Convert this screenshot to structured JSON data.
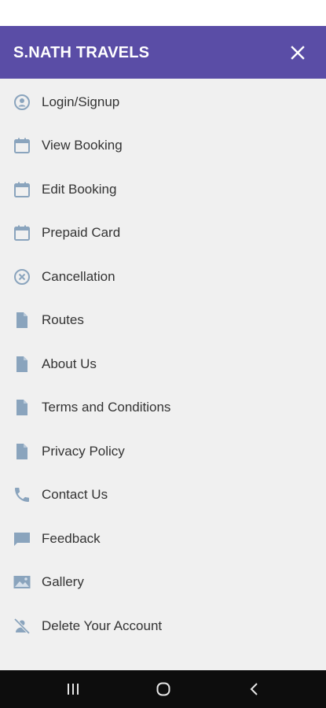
{
  "header": {
    "title": "S.NATH TRAVELS",
    "background_color": "#5a4da6"
  },
  "icon_color": "#8aa4bd",
  "menu": {
    "items": [
      {
        "label": "Login/Signup",
        "icon": "user-circle-icon"
      },
      {
        "label": "View Booking",
        "icon": "calendar-icon"
      },
      {
        "label": "Edit Booking",
        "icon": "calendar-icon"
      },
      {
        "label": "Prepaid Card",
        "icon": "calendar-icon"
      },
      {
        "label": "Cancellation",
        "icon": "cancel-circle-icon"
      },
      {
        "label": "Routes",
        "icon": "document-icon"
      },
      {
        "label": "About Us",
        "icon": "document-icon"
      },
      {
        "label": "Terms and Conditions",
        "icon": "document-icon"
      },
      {
        "label": "Privacy Policy",
        "icon": "document-icon"
      },
      {
        "label": "Contact Us",
        "icon": "phone-icon"
      },
      {
        "label": "Feedback",
        "icon": "chat-bubble-icon"
      },
      {
        "label": "Gallery",
        "icon": "image-icon"
      },
      {
        "label": "Delete Your Account",
        "icon": "user-remove-icon"
      }
    ]
  },
  "system_nav": {
    "buttons": [
      "recent-apps-icon",
      "home-icon",
      "back-icon"
    ]
  }
}
